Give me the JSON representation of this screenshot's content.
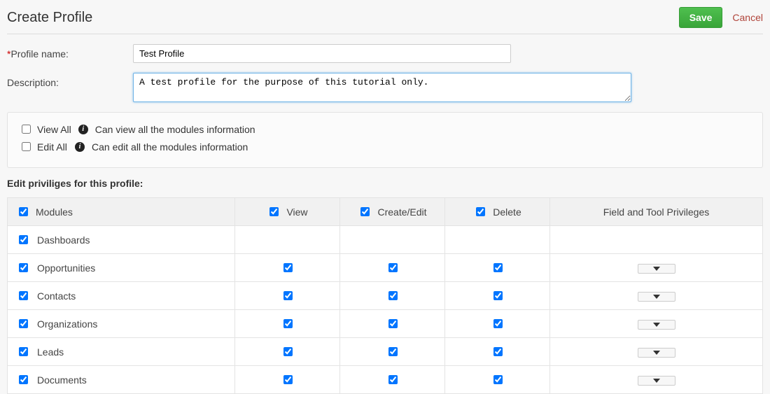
{
  "header": {
    "title": "Create Profile",
    "save_label": "Save",
    "cancel_label": "Cancel"
  },
  "form": {
    "profile_name_label": "Profile name:",
    "profile_name_value": "Test Profile",
    "description_label": "Description:",
    "description_value": "A test profile for the purpose of this tutorial only."
  },
  "global": {
    "view_all_label": "View All",
    "view_all_desc": "Can view all the modules information",
    "edit_all_label": "Edit All",
    "edit_all_desc": "Can edit all the modules information"
  },
  "section": {
    "heading": "Edit priviliges for this profile:"
  },
  "columns": {
    "modules": "Modules",
    "view": "View",
    "create_edit": "Create/Edit",
    "delete": "Delete",
    "priv": "Field and Tool Privileges"
  },
  "rows": [
    {
      "name": "Dashboards",
      "view": false,
      "create": false,
      "delete": false,
      "expand": false
    },
    {
      "name": "Opportunities",
      "view": true,
      "create": true,
      "delete": true,
      "expand": true
    },
    {
      "name": "Contacts",
      "view": true,
      "create": true,
      "delete": true,
      "expand": true
    },
    {
      "name": "Organizations",
      "view": true,
      "create": true,
      "delete": true,
      "expand": true
    },
    {
      "name": "Leads",
      "view": true,
      "create": true,
      "delete": true,
      "expand": true
    },
    {
      "name": "Documents",
      "view": true,
      "create": true,
      "delete": true,
      "expand": true
    }
  ]
}
